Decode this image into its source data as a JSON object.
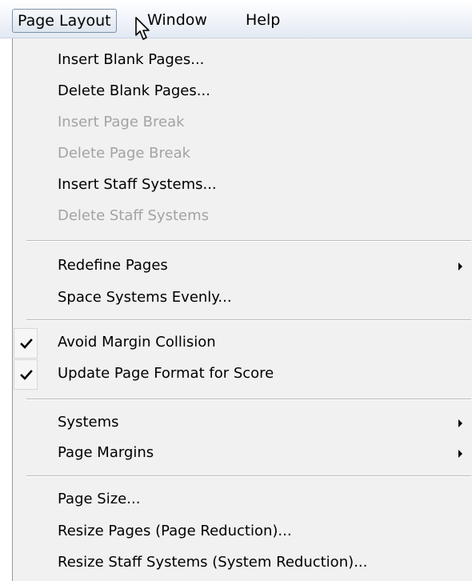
{
  "menubar": {
    "items": [
      {
        "label": "Page Layout"
      },
      {
        "label": "Window"
      },
      {
        "label": "Help"
      }
    ]
  },
  "menu": {
    "items": [
      {
        "label": "Insert Blank Pages...",
        "enabled": true
      },
      {
        "label": "Delete Blank Pages...",
        "enabled": true
      },
      {
        "label": "Insert Page Break",
        "enabled": false
      },
      {
        "label": "Delete Page Break",
        "enabled": false
      },
      {
        "label": "Insert Staff Systems...",
        "enabled": true
      },
      {
        "label": "Delete Staff Systems",
        "enabled": false
      },
      {
        "label": "Redefine Pages",
        "enabled": true,
        "submenu": true
      },
      {
        "label": "Space Systems Evenly...",
        "enabled": true
      },
      {
        "label": "Avoid Margin Collision",
        "enabled": true,
        "checked": true
      },
      {
        "label": "Update Page Format for Score",
        "enabled": true,
        "checked": true
      },
      {
        "label": "Systems",
        "enabled": true,
        "submenu": true
      },
      {
        "label": "Page Margins",
        "enabled": true,
        "submenu": true
      },
      {
        "label": "Page Size...",
        "enabled": true
      },
      {
        "label": "Resize Pages (Page Reduction)...",
        "enabled": true
      },
      {
        "label": "Resize Staff Systems (System Reduction)...",
        "enabled": true
      }
    ]
  },
  "icons": {
    "checkmark": "check-icon",
    "submenu_arrow": "submenu-arrow-icon",
    "cursor": "mouse-pointer-icon"
  }
}
